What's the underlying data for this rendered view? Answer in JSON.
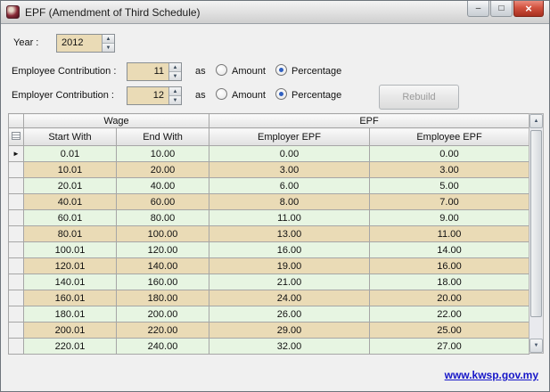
{
  "window": {
    "title": "EPF (Amendment of Third Schedule)"
  },
  "colors": {
    "row_green": "#e7f5e2",
    "row_tan": "#eadbb6",
    "link_blue": "#1515c8",
    "radio_blue": "#3060c0"
  },
  "icons": {
    "minimize": "–",
    "maximize": "□",
    "close": "×",
    "spinner_up": "▲",
    "spinner_down": "▼",
    "scroll_up": "▲",
    "scroll_down": "▼"
  },
  "form": {
    "year_label": "Year :",
    "year_value": "2012",
    "employee_label": "Employee Contribution :",
    "employee_value": "11",
    "employer_label": "Employer Contribution :",
    "employer_value": "12",
    "as_label": "as",
    "amount_label": "Amount",
    "percentage_label": "Percentage",
    "rebuild_label": "Rebuild"
  },
  "grid": {
    "group_wage": "Wage",
    "group_epf": "EPF",
    "columns": [
      "Start With",
      "End With",
      "Employer EPF",
      "Employee EPF"
    ],
    "row_marker": "►",
    "rows": [
      [
        "0.01",
        "10.00",
        "0.00",
        "0.00"
      ],
      [
        "10.01",
        "20.00",
        "3.00",
        "3.00"
      ],
      [
        "20.01",
        "40.00",
        "6.00",
        "5.00"
      ],
      [
        "40.01",
        "60.00",
        "8.00",
        "7.00"
      ],
      [
        "60.01",
        "80.00",
        "11.00",
        "9.00"
      ],
      [
        "80.01",
        "100.00",
        "13.00",
        "11.00"
      ],
      [
        "100.01",
        "120.00",
        "16.00",
        "14.00"
      ],
      [
        "120.01",
        "140.00",
        "19.00",
        "16.00"
      ],
      [
        "140.01",
        "160.00",
        "21.00",
        "18.00"
      ],
      [
        "160.01",
        "180.00",
        "24.00",
        "20.00"
      ],
      [
        "180.01",
        "200.00",
        "26.00",
        "22.00"
      ],
      [
        "200.01",
        "220.00",
        "29.00",
        "25.00"
      ],
      [
        "220.01",
        "240.00",
        "32.00",
        "27.00"
      ]
    ]
  },
  "footer": {
    "link": "www.kwsp.gov.my"
  }
}
